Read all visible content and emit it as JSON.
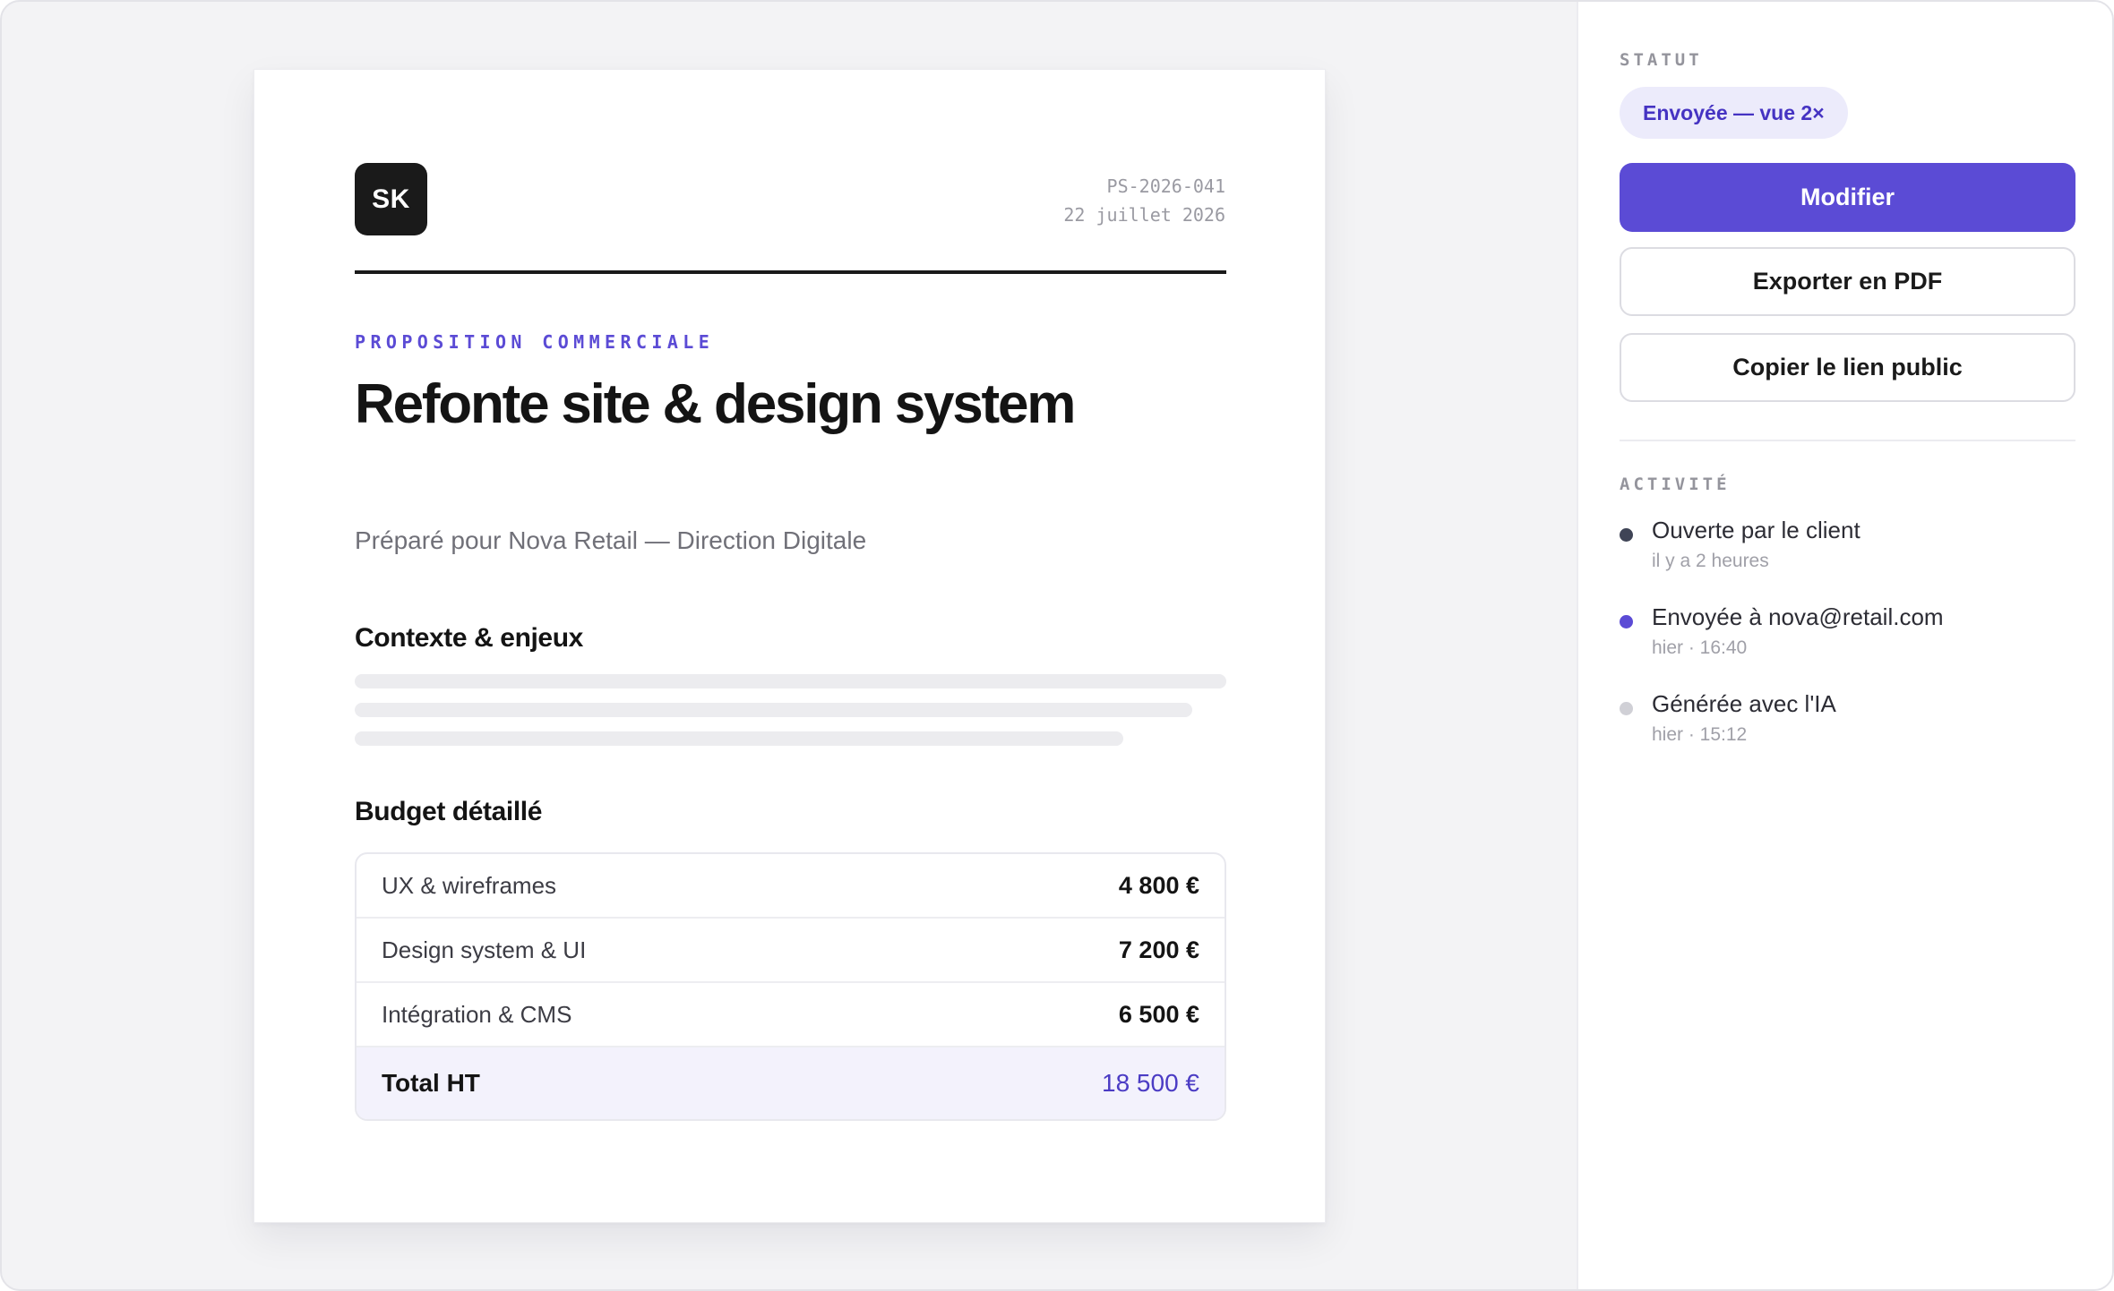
{
  "document": {
    "logo_initials": "SK",
    "reference": "PS-2026-041",
    "date": "22 juillet 2026",
    "kicker": "PROPOSITION COMMERCIALE",
    "title": "Refonte site & design system",
    "subtitle": "Préparé pour Nova Retail — Direction Digitale",
    "context_heading": "Contexte & enjeux",
    "budget_heading": "Budget détaillé",
    "budget_rows": [
      {
        "label": "UX & wireframes",
        "amount": "4 800 €"
      },
      {
        "label": "Design system & UI",
        "amount": "7 200 €"
      },
      {
        "label": "Intégration & CMS",
        "amount": "6 500 €"
      }
    ],
    "budget_total": {
      "label": "Total HT",
      "amount": "18 500 €"
    }
  },
  "sidebar": {
    "status_label": "STATUT",
    "status_badge": "Envoyée — vue 2×",
    "buttons": {
      "edit": "Modifier",
      "export_pdf": "Exporter en PDF",
      "copy_link": "Copier le lien public"
    },
    "activity_label": "ACTIVITÉ",
    "activity": [
      {
        "title": "Ouverte par le client",
        "time": "il y a 2 heures",
        "dot_color": "#3f4456"
      },
      {
        "title": "Envoyée à nova@retail.com",
        "time": "hier · 16:40",
        "dot_color": "#5b4bd5"
      },
      {
        "title": "Générée avec l'IA",
        "time": "hier · 15:12",
        "dot_color": "#d0d0d6"
      }
    ]
  },
  "colors": {
    "accent": "#5b4bd5",
    "accent_soft": "#ecebfb",
    "ink": "#141414",
    "muted": "#707078"
  }
}
